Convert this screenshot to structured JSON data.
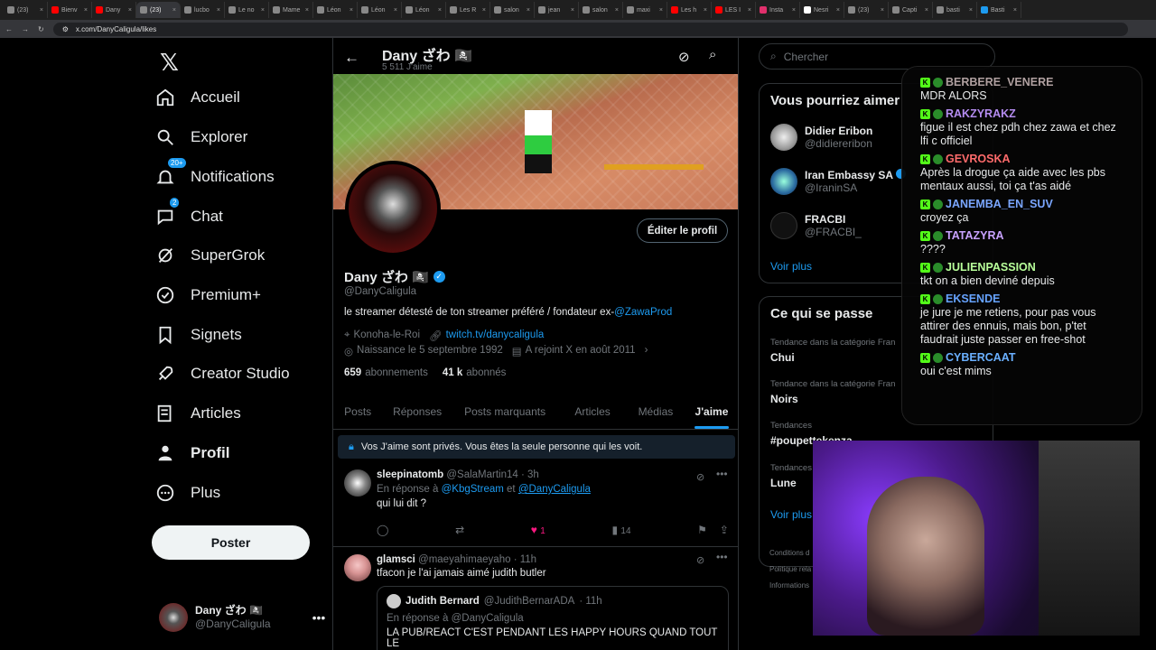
{
  "browser": {
    "tabs": [
      {
        "label": "(23)",
        "color": "#888"
      },
      {
        "label": "Bienv",
        "color": "#ff0000"
      },
      {
        "label": "Dany",
        "color": "#ff0000"
      },
      {
        "label": "(23)",
        "color": "#888",
        "active": true
      },
      {
        "label": "lucbo",
        "color": "#888"
      },
      {
        "label": "Le no",
        "color": "#888"
      },
      {
        "label": "Mame",
        "color": "#888"
      },
      {
        "label": "Léon",
        "color": "#888"
      },
      {
        "label": "Léon",
        "color": "#888"
      },
      {
        "label": "Léon",
        "color": "#888"
      },
      {
        "label": "Les R",
        "color": "#888"
      },
      {
        "label": "salon",
        "color": "#888"
      },
      {
        "label": "jean",
        "color": "#888"
      },
      {
        "label": "salon",
        "color": "#888"
      },
      {
        "label": "maxi",
        "color": "#888"
      },
      {
        "label": "Les h",
        "color": "#ff0000"
      },
      {
        "label": "LES I",
        "color": "#ff0000"
      },
      {
        "label": "Insta",
        "color": "#e1306c"
      },
      {
        "label": "Nesri",
        "color": "#fff"
      },
      {
        "label": "(23)",
        "color": "#888"
      },
      {
        "label": "Capti",
        "color": "#888"
      },
      {
        "label": "basti",
        "color": "#888"
      },
      {
        "label": "Basti",
        "color": "#1d9bf0"
      }
    ],
    "url": "x.com/DanyCaligula/likes"
  },
  "nav": {
    "items": [
      "Accueil",
      "Explorer",
      "Notifications",
      "Chat",
      "SuperGrok",
      "Premium+",
      "Signets",
      "Creator Studio",
      "Articles",
      "Profil",
      "Plus"
    ],
    "notif_badge": "20+",
    "chat_badge": "2",
    "post_button": "Poster",
    "account_name": "Dany ざわ 🏴‍☠️",
    "account_handle": "@DanyCaligula"
  },
  "profile": {
    "header_name": "Dany ざわ 🏴‍☠️",
    "header_count": "5 511 J'aime",
    "edit_button": "Éditer le profil",
    "name": "Dany ざわ 🏴‍☠️",
    "handle": "@DanyCaligula",
    "bio_prefix": "le streamer détesté de ton streamer préféré / fondateur ex-",
    "bio_link": "@ZawaProd",
    "location": "Konoha-le-Roi",
    "website": "twitch.tv/danycaligula",
    "birth": "Naissance le 5 septembre 1992",
    "joined": "A rejoint X en août 2011",
    "following_num": "659",
    "following_label": "abonnements",
    "followers_num": "41 k",
    "followers_label": "abonnés",
    "tabs": [
      "Posts",
      "Réponses",
      "Posts marquants",
      "Articles",
      "Médias",
      "J'aime"
    ],
    "notice": "Vos J'aime sont privés. Vous êtes la seule personne qui les voit."
  },
  "tweets": [
    {
      "name": "sleepinatomb",
      "handle": "@SalaMartin14",
      "time": "· 3h",
      "reply_to": "En réponse à",
      "mention1": "@KbgStream",
      "and": "et",
      "mention2": "@DanyCaligula",
      "text": "qui lui dit ?",
      "likes": "1",
      "views": "14"
    },
    {
      "name": "glamsci",
      "handle": "@maeyahimaeyaho",
      "time": "· 11h",
      "text": "tfacon je l'ai jamais aimé judith butler",
      "quote_name": "Judith Bernard",
      "quote_handle": "@JudithBernarADA",
      "quote_time": "· 11h",
      "quote_reply": "En réponse à @DanyCaligula",
      "quote_text": "LA PUB/REACT C'EST PENDANT LES HAPPY HOURS QUAND TOUT LE"
    }
  ],
  "right": {
    "search_placeholder": "Chercher",
    "wtf_title": "Vous pourriez aimer",
    "wtf": [
      {
        "name": "Didier Eribon",
        "handle": "@didiereribon"
      },
      {
        "name": "Iran Embassy SA",
        "handle": "@IraninSA"
      },
      {
        "name": "FRACBI",
        "handle": "@FRACBI_"
      }
    ],
    "show_more": "Voir plus",
    "trends_title": "Ce qui se passe",
    "trends": [
      {
        "label": "Tendance dans la catégorie Fran",
        "name": "Chui"
      },
      {
        "label": "Tendance dans la catégorie Fran",
        "name": "Noirs"
      },
      {
        "label": "Tendances",
        "name": "#poupettekenza"
      },
      {
        "label": "Tendances",
        "name": "Lune"
      }
    ],
    "show_more2": "Voir plus",
    "footer1": "Conditions d",
    "footer2": "Politique rela",
    "footer3": "Informations"
  },
  "chat": {
    "messages": [
      {
        "user": "BERBERE_VENERE",
        "color": "#b0a0a0",
        "text": "MDR ALORS"
      },
      {
        "user": "RAKZYRAKZ",
        "color": "#b48cf0",
        "text": "figue il est chez pdh chez zawa et chez lfi c officiel"
      },
      {
        "user": "GEVROSKA",
        "color": "#ff6b6b",
        "text": "Après la drogue ça aide avec les pbs mentaux aussi, toi ça t'as aidé"
      },
      {
        "user": "JANEMBA_EN_SUV",
        "color": "#7aa6ff",
        "text": "croyez ça"
      },
      {
        "user": "TATAZYRA",
        "color": "#c8a2ff",
        "text": "????"
      },
      {
        "user": "JULIENPASSION",
        "color": "#b8ff9a",
        "text": "tkt on a bien deviné depuis"
      },
      {
        "user": "EKSENDE",
        "color": "#66a3ff",
        "text": "je jure je me retiens, pour pas vous attirer des ennuis, mais bon, p'tet faudrait juste passer en free-shot"
      },
      {
        "user": "CYBERCAAT",
        "color": "#6ab0ff",
        "text": "oui c'est mims"
      }
    ]
  }
}
